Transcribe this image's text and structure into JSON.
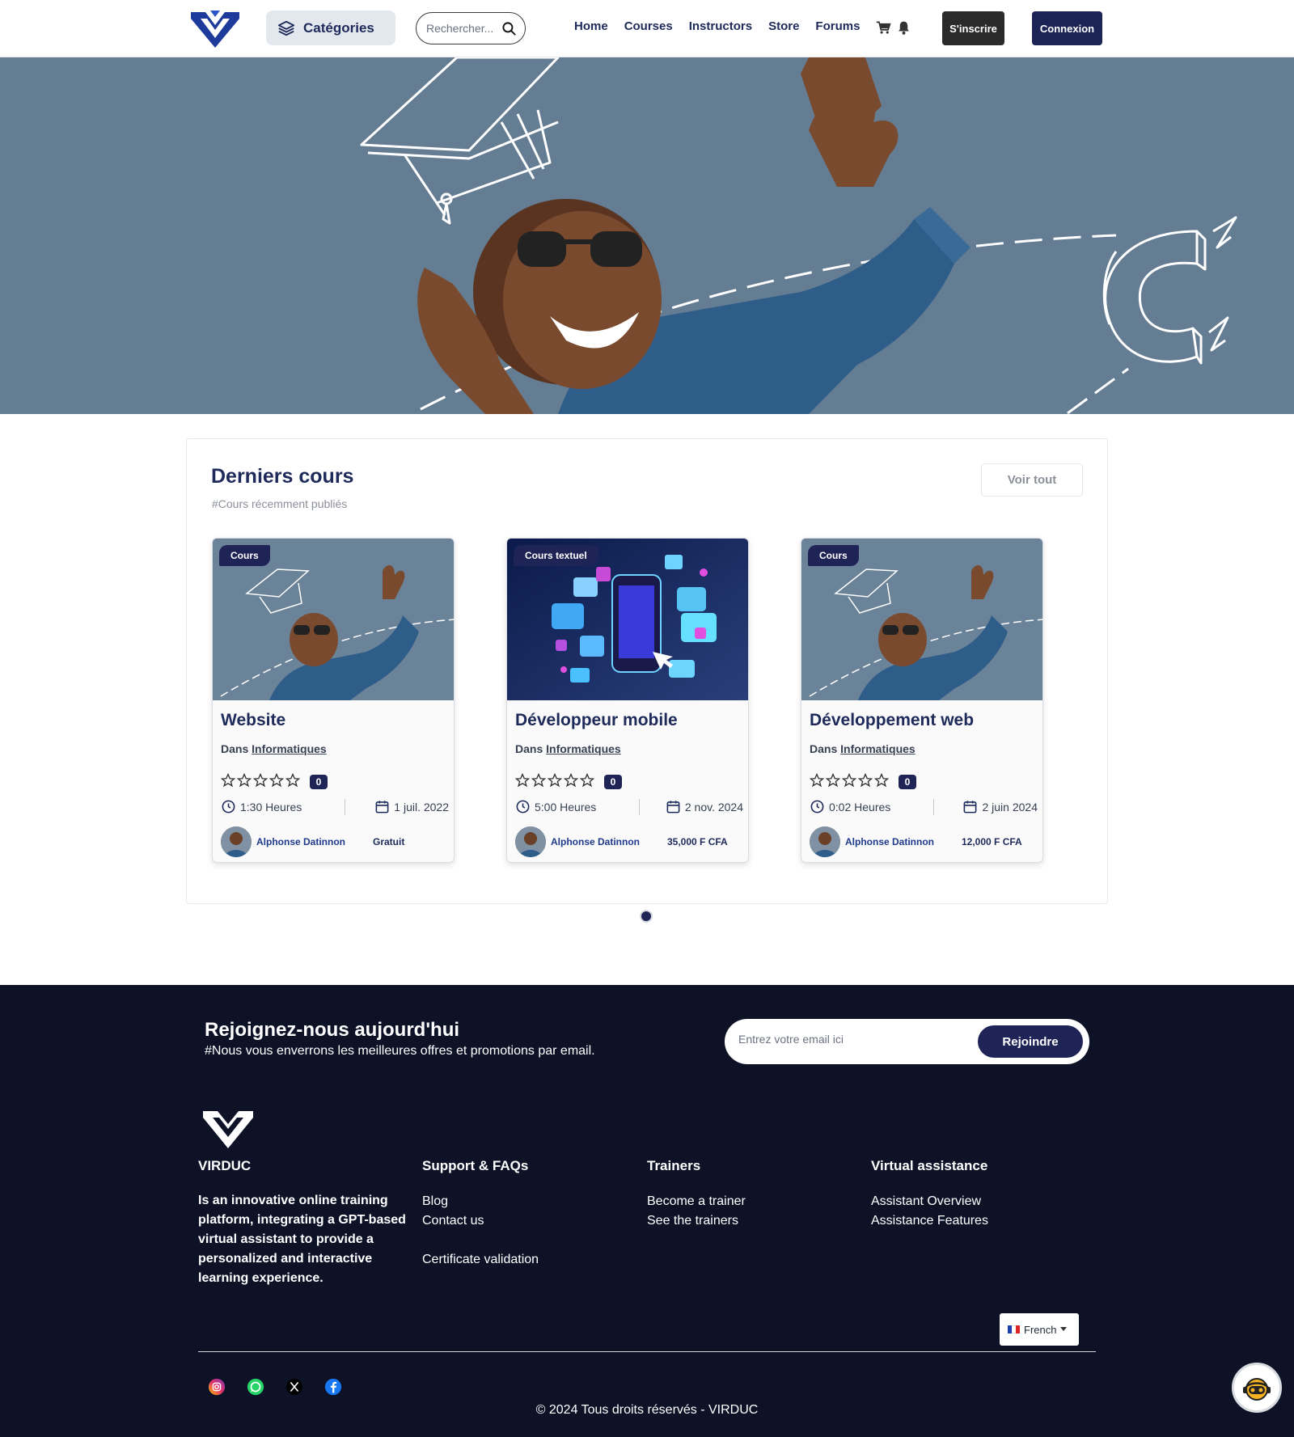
{
  "nav": {
    "categories_label": "Catégories",
    "search_placeholder": "Rechercher...",
    "links": [
      "Home",
      "Courses",
      "Instructors",
      "Store",
      "Forums"
    ],
    "signup_label": "S'inscrire",
    "login_label": "Connexion"
  },
  "section": {
    "title": "Derniers cours",
    "subtitle": "#Cours récemment publiés",
    "view_all": "Voir tout"
  },
  "courses": [
    {
      "badge": "Cours",
      "title": "Website",
      "in_label": "Dans",
      "category": "Informatiques",
      "rating": 0,
      "reviews": "0",
      "duration": "1:30 Heures",
      "date": "1 juil. 2022",
      "author": "Alphonse Datinnon",
      "price": "Gratuit"
    },
    {
      "badge": "Cours textuel",
      "title": "Développeur mobile",
      "in_label": "Dans",
      "category": "Informatiques",
      "rating": 0,
      "reviews": "0",
      "duration": "5:00 Heures",
      "date": "2 nov. 2024",
      "author": "Alphonse Datinnon",
      "price": "35,000 F CFA"
    },
    {
      "badge": "Cours",
      "title": "Développement web",
      "in_label": "Dans",
      "category": "Informatiques",
      "rating": 0,
      "reviews": "0",
      "duration": "0:02 Heures",
      "date": "2 juin 2024",
      "author": "Alphonse Datinnon",
      "price": "12,000 F CFA"
    }
  ],
  "carousel": {
    "pages": 1,
    "active": 1
  },
  "footer": {
    "newsletter_title": "Rejoignez-nous aujourd'hui",
    "newsletter_sub": "#Nous vous enverrons les meilleures offres et promotions par email.",
    "email_placeholder": "Entrez votre email ici",
    "join_label": "Rejoindre",
    "brand": "VIRDUC",
    "about": "Is an innovative online training platform, integrating a GPT-based virtual assistant to provide a personalized and interactive learning experience.",
    "support_title": "Support & FAQs",
    "support_links": [
      "Blog",
      "Contact us",
      "",
      "Certificate validation"
    ],
    "trainers_title": "Trainers",
    "trainers_links": [
      "Become a trainer",
      "See the trainers"
    ],
    "assist_title": "Virtual assistance",
    "assist_links": [
      "Assistant Overview",
      "Assistance Features"
    ],
    "language": "French",
    "socials": [
      "instagram-icon",
      "whatsapp-icon",
      "x-icon",
      "facebook-icon"
    ],
    "copyright": "© 2024 Tous droits réservés - VIRDUC"
  },
  "colors": {
    "primary": "#1e2456",
    "hero_bg": "#647d92",
    "footer_bg": "#0d1227",
    "text_dark": "#1e2a5a"
  }
}
